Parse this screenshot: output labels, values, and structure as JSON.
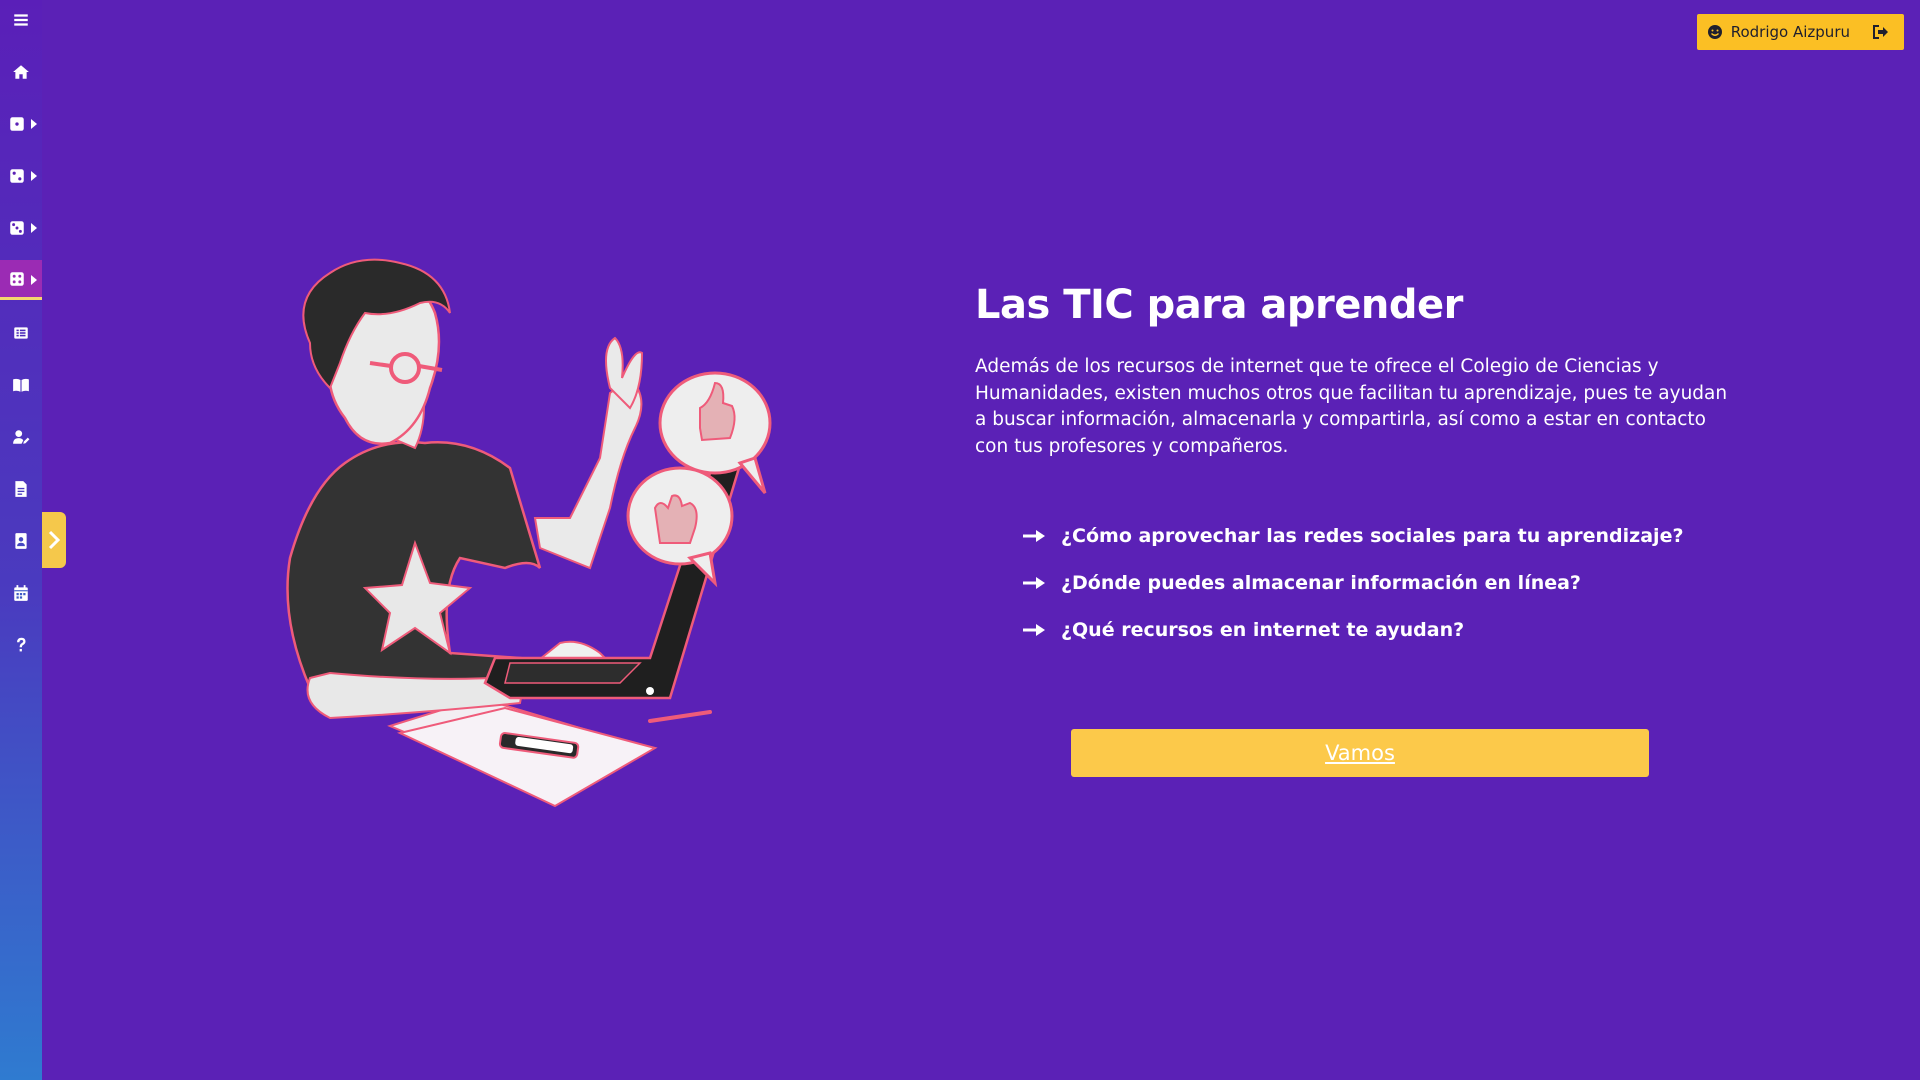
{
  "header": {
    "user_name": "Rodrigo Aizpuru",
    "user_icon": "smile-icon",
    "logout_icon": "logout-icon"
  },
  "sidebar": {
    "items": [
      {
        "name": "menu",
        "icon": "hamburger-icon"
      },
      {
        "name": "home",
        "icon": "home-icon"
      },
      {
        "name": "unit-1",
        "icon": "dice-one-icon",
        "has_submenu": true
      },
      {
        "name": "unit-2",
        "icon": "dice-two-icon",
        "has_submenu": true
      },
      {
        "name": "unit-3",
        "icon": "dice-three-icon",
        "has_submenu": true
      },
      {
        "name": "unit-4",
        "icon": "dice-four-icon",
        "has_submenu": true,
        "active": true
      },
      {
        "name": "list",
        "icon": "list-icon"
      },
      {
        "name": "book",
        "icon": "book-icon"
      },
      {
        "name": "user-edit",
        "icon": "user-edit-icon"
      },
      {
        "name": "document",
        "icon": "file-icon"
      },
      {
        "name": "contact",
        "icon": "contact-card-icon"
      },
      {
        "name": "calendar",
        "icon": "calendar-icon"
      },
      {
        "name": "help",
        "icon": "question-icon"
      }
    ],
    "accent": "#f5d76e"
  },
  "main": {
    "title": "Las TIC para aprender",
    "description": "Además de los recursos de internet que te ofrece el Colegio de Ciencias y Humanidades, existen muchos otros que facilitan tu aprendizaje, pues te ayudan a buscar información, almacenarla y compartirla, así como a estar en contacto con tus profesores y compañeros.",
    "links": [
      {
        "label": "¿Cómo aprovechar las redes sociales para tu aprendizaje?"
      },
      {
        "label": "¿Dónde puedes almacenar información en línea?"
      },
      {
        "label": "¿Qué recursos en internet te ayudan?"
      }
    ],
    "cta_label": "Vamos"
  },
  "colors": {
    "background": "#5b21b6",
    "button": "#fcc94a",
    "accent_pink": "#ef5b7a"
  }
}
